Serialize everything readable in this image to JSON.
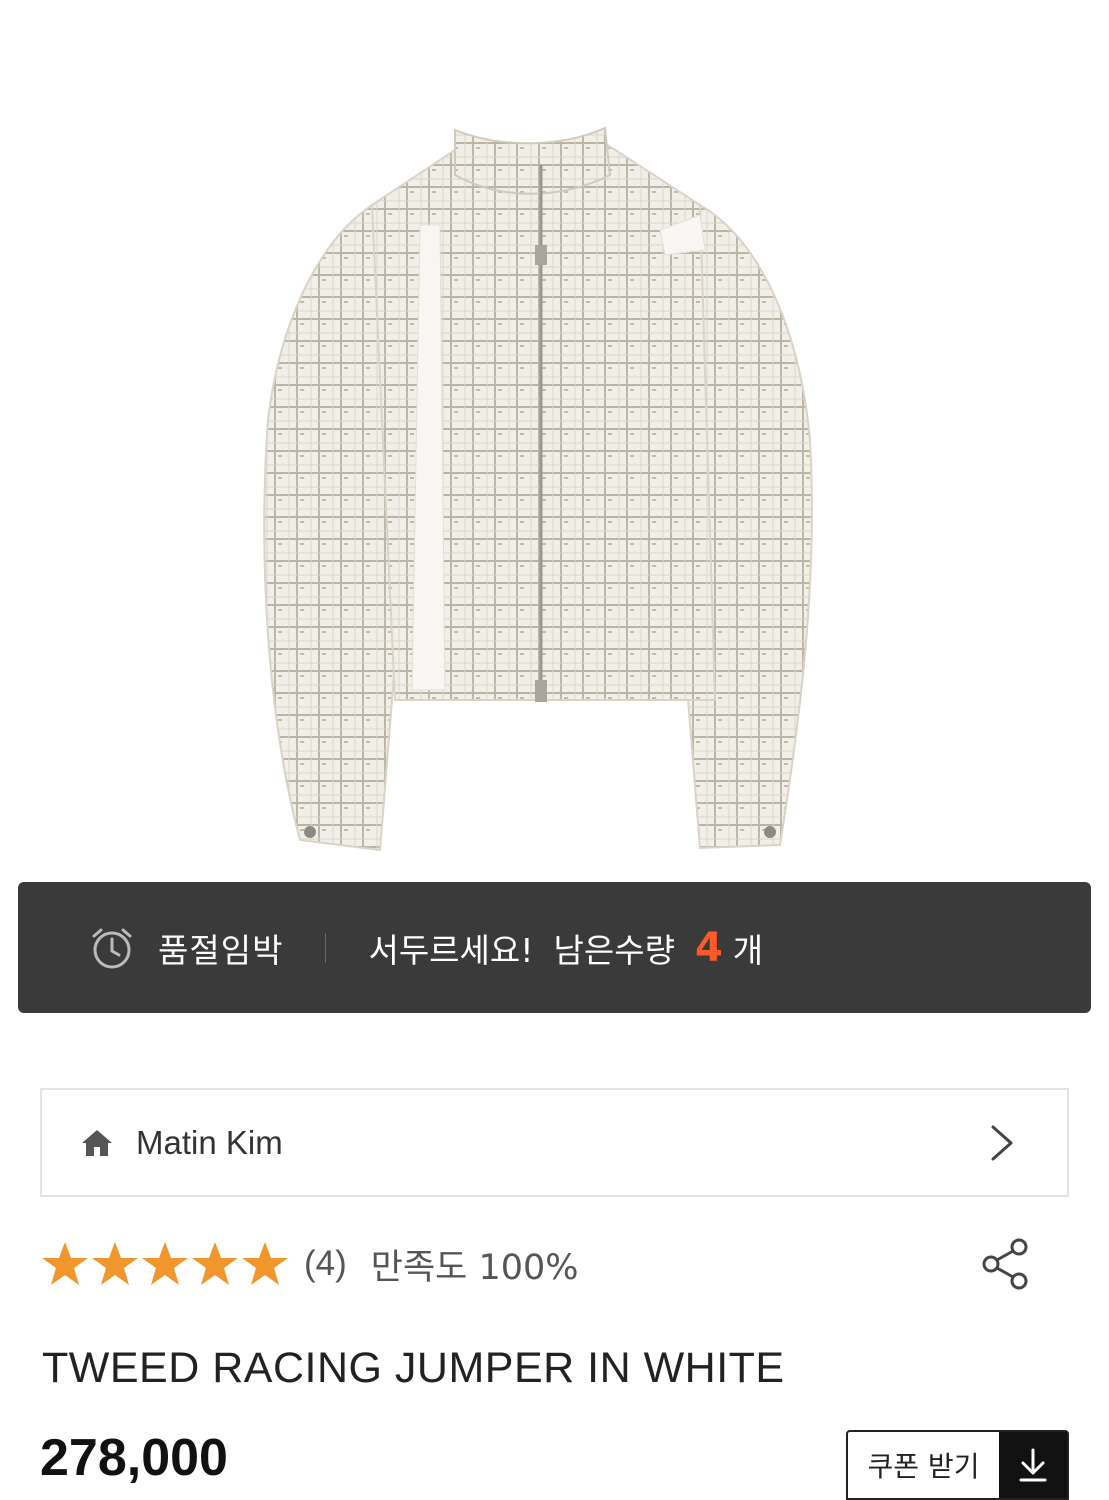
{
  "product_image": {
    "alt": ""
  },
  "stock_banner": {
    "icon": "alarm-clock-icon",
    "label": "품절임박",
    "hurry_text": "서두르세요!",
    "remaining_label": "남은수량",
    "remaining_count": "4",
    "unit": "개",
    "count_color": "#ff5a2a"
  },
  "brand": {
    "icon": "home-icon",
    "name": "Matin Kim",
    "chevron_icon": "chevron-right-icon"
  },
  "rating": {
    "stars": 5,
    "max_stars": 5,
    "star_color": "#f0962c",
    "review_count": "(4)",
    "satisfaction": "만족도 100%"
  },
  "share": {
    "icon": "share-icon"
  },
  "product": {
    "title": "TWEED RACING JUMPER IN WHITE",
    "price": "278,000"
  },
  "coupon": {
    "label": "쿠폰 받기",
    "icon": "download-arrow-icon"
  }
}
